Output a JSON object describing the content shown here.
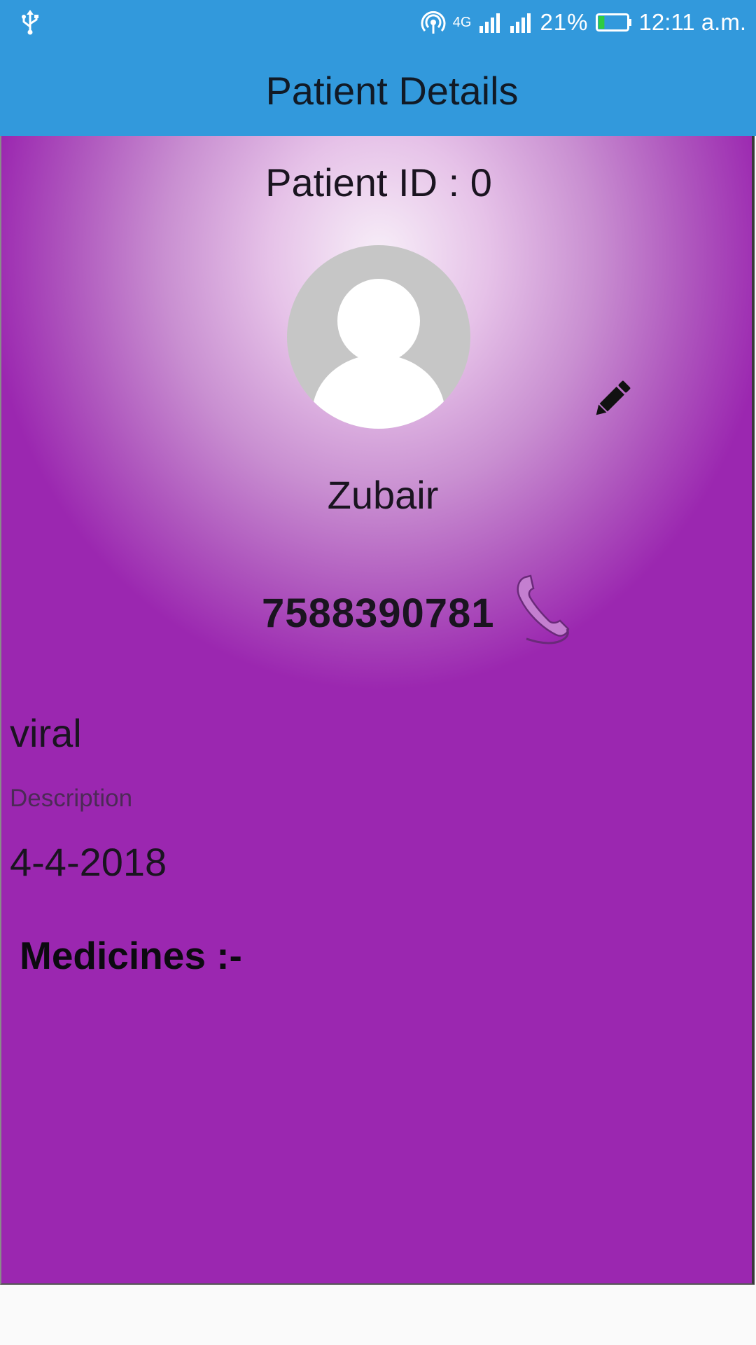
{
  "status_bar": {
    "usb_icon": "usb-icon",
    "hotspot_icon": "hotspot-icon",
    "network_type": "4G",
    "battery_percent": "21%",
    "battery_level": 0.21,
    "time": "12:11 a.m."
  },
  "app_bar": {
    "title": "Patient Details"
  },
  "patient": {
    "id_label": "Patient ID : 0",
    "avatar_icon": "person-avatar-icon",
    "edit_icon": "edit-pencil-icon",
    "name": "Zubair",
    "phone": "7588390781",
    "phone_icon": "phone-icon",
    "diagnosis": "viral",
    "description_label": "Description",
    "date": "4-4-2018",
    "medicines_heading": "Medicines :-"
  },
  "colors": {
    "app_bar": "#3299dc",
    "content_purple": "#9b27b0",
    "text_dark": "#1a1420"
  }
}
